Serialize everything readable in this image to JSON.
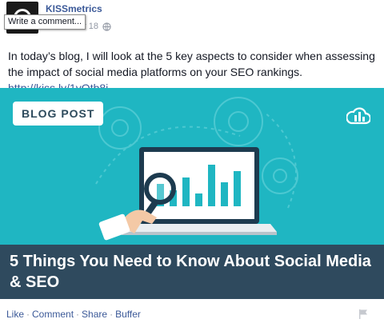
{
  "header": {
    "page_name": "KISSmetrics",
    "date": "November 18",
    "tooltip": "Write a comment..."
  },
  "post": {
    "text": "In today’s blog, I will look at the 5 key aspects to consider when assessing the impact of social media platforms on your SEO rankings.",
    "link": "http://kiss.ly/1yQtb8j"
  },
  "image": {
    "badge": "BLOG POST",
    "title": "5 Things You Need to Know About Social Media & SEO",
    "colors": {
      "background": "#1fb6c2",
      "title_band": "#2f4a5e",
      "screen": "#1d3b4f"
    }
  },
  "actions": {
    "like": "Like",
    "comment": "Comment",
    "share": "Share",
    "buffer": "Buffer",
    "separator": "·"
  },
  "icons": [
    "globe-icon",
    "flag-icon",
    "kissmetrics-logo-icon",
    "magnifier-icon"
  ]
}
